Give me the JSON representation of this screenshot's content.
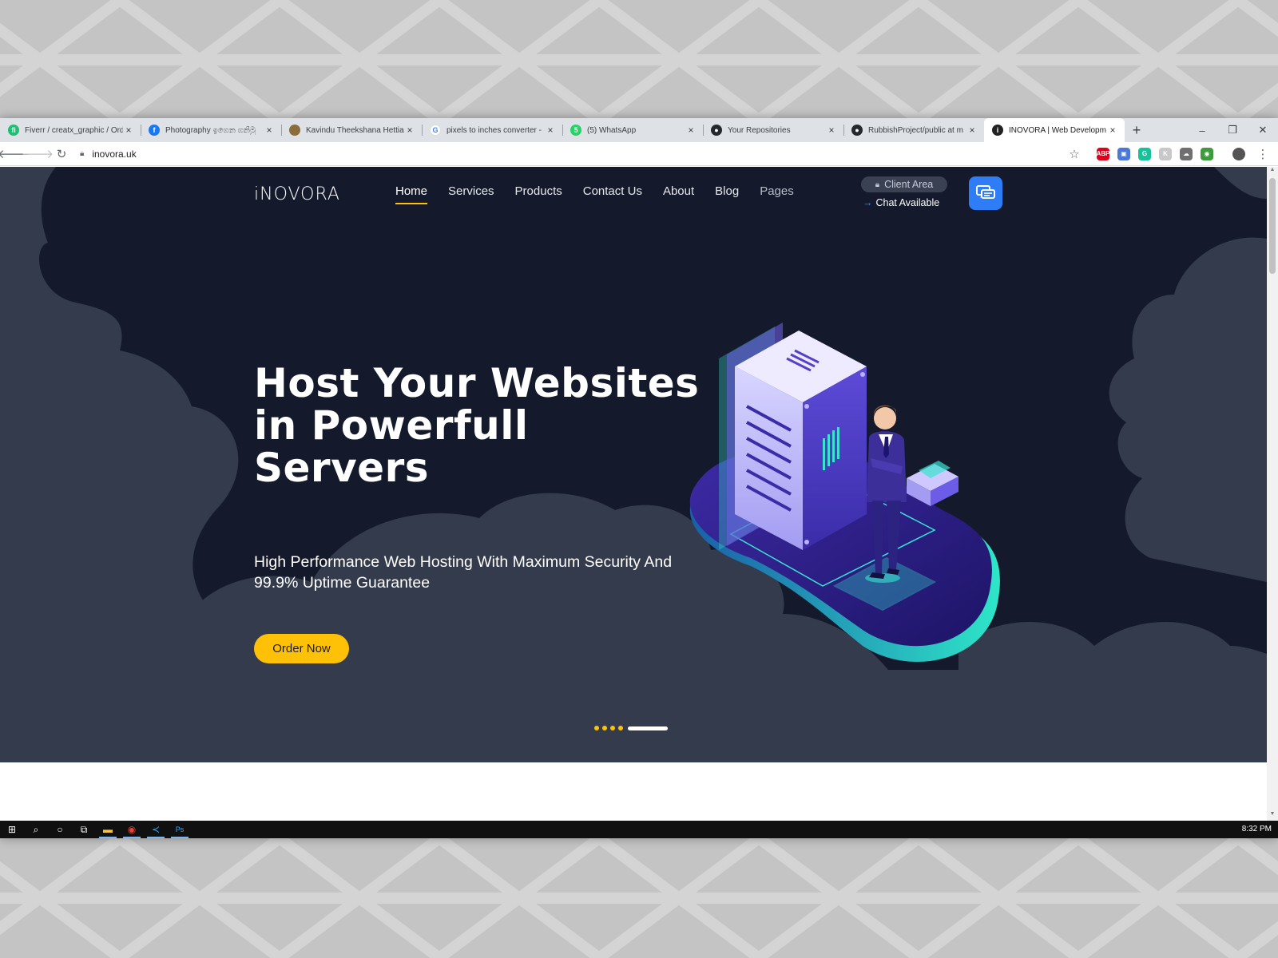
{
  "browser": {
    "tabs": [
      {
        "title": "Fiverr / creatx_graphic / Ord",
        "favicon": "fiverr-icon",
        "color": "#1dbf73",
        "glyph": "fi",
        "active": false
      },
      {
        "title": "Photography ඉගෙන ගනිමු",
        "favicon": "facebook-icon",
        "color": "#1877f2",
        "glyph": "f",
        "active": false
      },
      {
        "title": "Kavindu Theekshana Hettia",
        "favicon": "avatar-icon",
        "color": "#8a6d3b",
        "glyph": "",
        "active": false
      },
      {
        "title": "pixels to inches converter -",
        "favicon": "google-icon",
        "color": "#ffffff",
        "glyph": "G",
        "active": false
      },
      {
        "title": "(5) WhatsApp",
        "favicon": "whatsapp-icon",
        "color": "#25d366",
        "glyph": "5",
        "active": false
      },
      {
        "title": "Your Repositories",
        "favicon": "github-icon",
        "color": "#24292e",
        "glyph": "●",
        "active": false
      },
      {
        "title": "RubbishProject/public at m",
        "favicon": "github-icon",
        "color": "#24292e",
        "glyph": "●",
        "active": false
      },
      {
        "title": "INOVORA | Web Developm",
        "favicon": "inovora-icon",
        "color": "#222222",
        "glyph": "i",
        "active": true
      }
    ],
    "new_tab": "+",
    "window_controls": {
      "minimize": "–",
      "restore": "❐",
      "close": "✕"
    },
    "url": "inovora.uk",
    "extensions": [
      {
        "name": "abp-icon",
        "color": "#e0001b",
        "glyph": "ABP"
      },
      {
        "name": "extension-save-icon",
        "color": "#4a78d8",
        "glyph": "▣"
      },
      {
        "name": "grammarly-icon",
        "color": "#15c39a",
        "glyph": "G"
      },
      {
        "name": "extension-k-icon",
        "color": "#c8c8c8",
        "glyph": "K"
      },
      {
        "name": "cloud-icon",
        "color": "#6f6f6f",
        "glyph": "☁"
      },
      {
        "name": "extension-globe-icon",
        "color": "#3d9a3d",
        "glyph": "◉"
      }
    ]
  },
  "site": {
    "logo": "iNOVORA",
    "nav": [
      "Home",
      "Services",
      "Products",
      "Contact Us",
      "About",
      "Blog",
      "Pages"
    ],
    "client_area": "Client Area",
    "chat_available": "Chat Available",
    "hero": {
      "title": "Host Your Websites in Powerfull Servers",
      "subtitle": "High Performance Web Hosting With Maximum Security And 99.9% Uptime Guarantee",
      "cta": "Order Now"
    },
    "slider": {
      "count": 5,
      "active_index": 4
    },
    "colors": {
      "hero_bg": "#141a2b",
      "cloud": "#343b4c",
      "accent": "#ffc107",
      "chat_button": "#2f7df6"
    }
  },
  "taskbar": {
    "items": [
      "windows-start-icon",
      "search-icon",
      "cortana-icon",
      "task-view-icon",
      "file-explorer-icon",
      "chrome-icon",
      "vscode-icon",
      "photoshop-icon"
    ],
    "clock": "8:32 PM"
  }
}
